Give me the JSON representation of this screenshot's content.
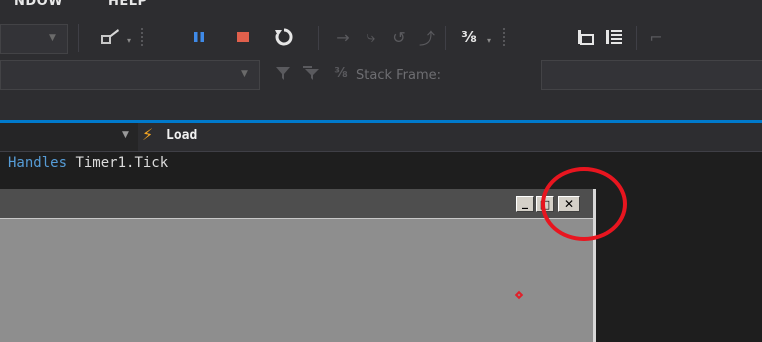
{
  "menu": {
    "window_label": "NDOW",
    "help_label": "HELP"
  },
  "toolbar_debug": {
    "icons": [
      "attach-process-icon",
      "pause-icon",
      "stop-icon",
      "restart-icon",
      "show-next-statement-icon",
      "step-into-icon",
      "step-over-icon",
      "step-out-icon",
      "hex-display-icon",
      "threads-icon",
      "comment-icon"
    ],
    "pause_color": "#3f8ae8",
    "stop_color": "#e0604c"
  },
  "toolbar_locations": {
    "stack_frame_label": "Stack Frame:",
    "stack_frame_value": ""
  },
  "nav_bar": {
    "event_label": "Load",
    "event_icon": "lightning-icon",
    "event_icon_color": "#f5a623"
  },
  "code": {
    "keyword": "Handles",
    "handler": "Timer1.Tick"
  },
  "form_window": {
    "minimize_glyph": "_",
    "maximize_glyph": "□",
    "close_glyph": "✕"
  },
  "annotation": {
    "circle_color": "#e8151f"
  }
}
